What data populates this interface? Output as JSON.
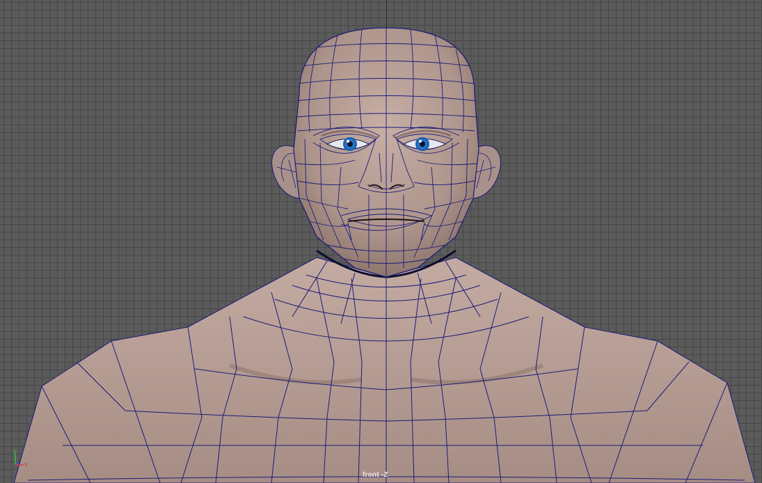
{
  "viewport": {
    "camera_label": "front -Z",
    "colors": {
      "background": "#5b5b5b",
      "grid": "#474747",
      "skin": "#b49a90",
      "wireframe": "#1a1a7a",
      "iris": "#3b8ad8"
    }
  },
  "axis_gizmo": {
    "y_label": "y",
    "x_label": "x",
    "y_color": "#3fbf3f",
    "x_color": "#d93a3a"
  }
}
